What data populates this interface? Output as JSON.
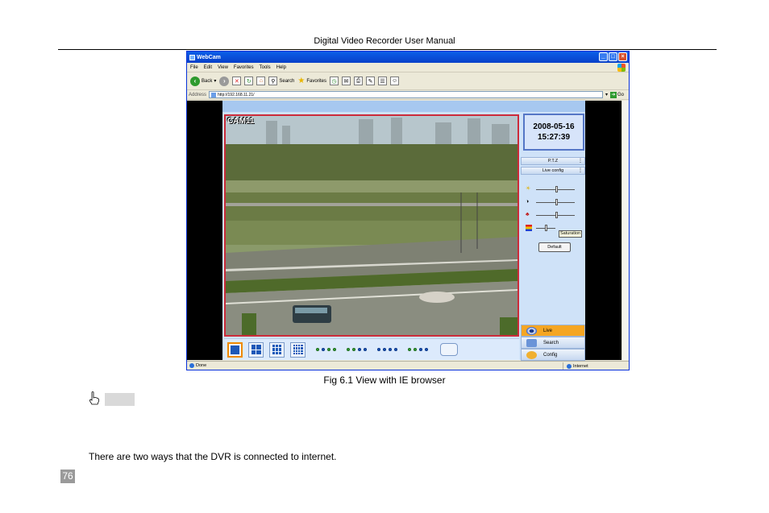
{
  "header": {
    "title": "Digital Video Recorder User Manual"
  },
  "window": {
    "title": "WebCam",
    "controls": [
      "_",
      "□",
      "×"
    ],
    "menu": [
      "File",
      "Edit",
      "View",
      "Favorites",
      "Tools",
      "Help"
    ],
    "toolbar": {
      "back": "Back",
      "search": "Search",
      "favorites": "Favorites"
    },
    "address": {
      "label": "Address",
      "url": "http://192.168.11.21/",
      "go": "Go"
    },
    "status": {
      "left": "Done",
      "zone": "Internet"
    }
  },
  "dvr": {
    "camera_label": "CAM11",
    "date": "2008-05-16",
    "time": "15:27:39",
    "ptz_label": "P.T.Z",
    "live_config_label": "Live config",
    "sliders": [
      {
        "name": "brightness",
        "icon": "sun-icon",
        "level": 0.55
      },
      {
        "name": "contrast",
        "icon": "contrast-icon",
        "level": 0.55
      },
      {
        "name": "hue",
        "icon": "hue-icon",
        "level": 0.55
      },
      {
        "name": "saturation",
        "icon": "saturation-icon",
        "level": 0.55
      }
    ],
    "tooltip": "Saturation",
    "default_label": "Default",
    "nav": {
      "live": "Live",
      "search": "Search",
      "config": "Config"
    },
    "colors": {
      "accent": "#f5a623",
      "video_border": "#cc2b3a",
      "panel": "#cfe2f8"
    }
  },
  "caption": "Fig 6.1 View with IE browser",
  "body_text": "There are two ways that the DVR is connected to internet.",
  "page_number": "76"
}
